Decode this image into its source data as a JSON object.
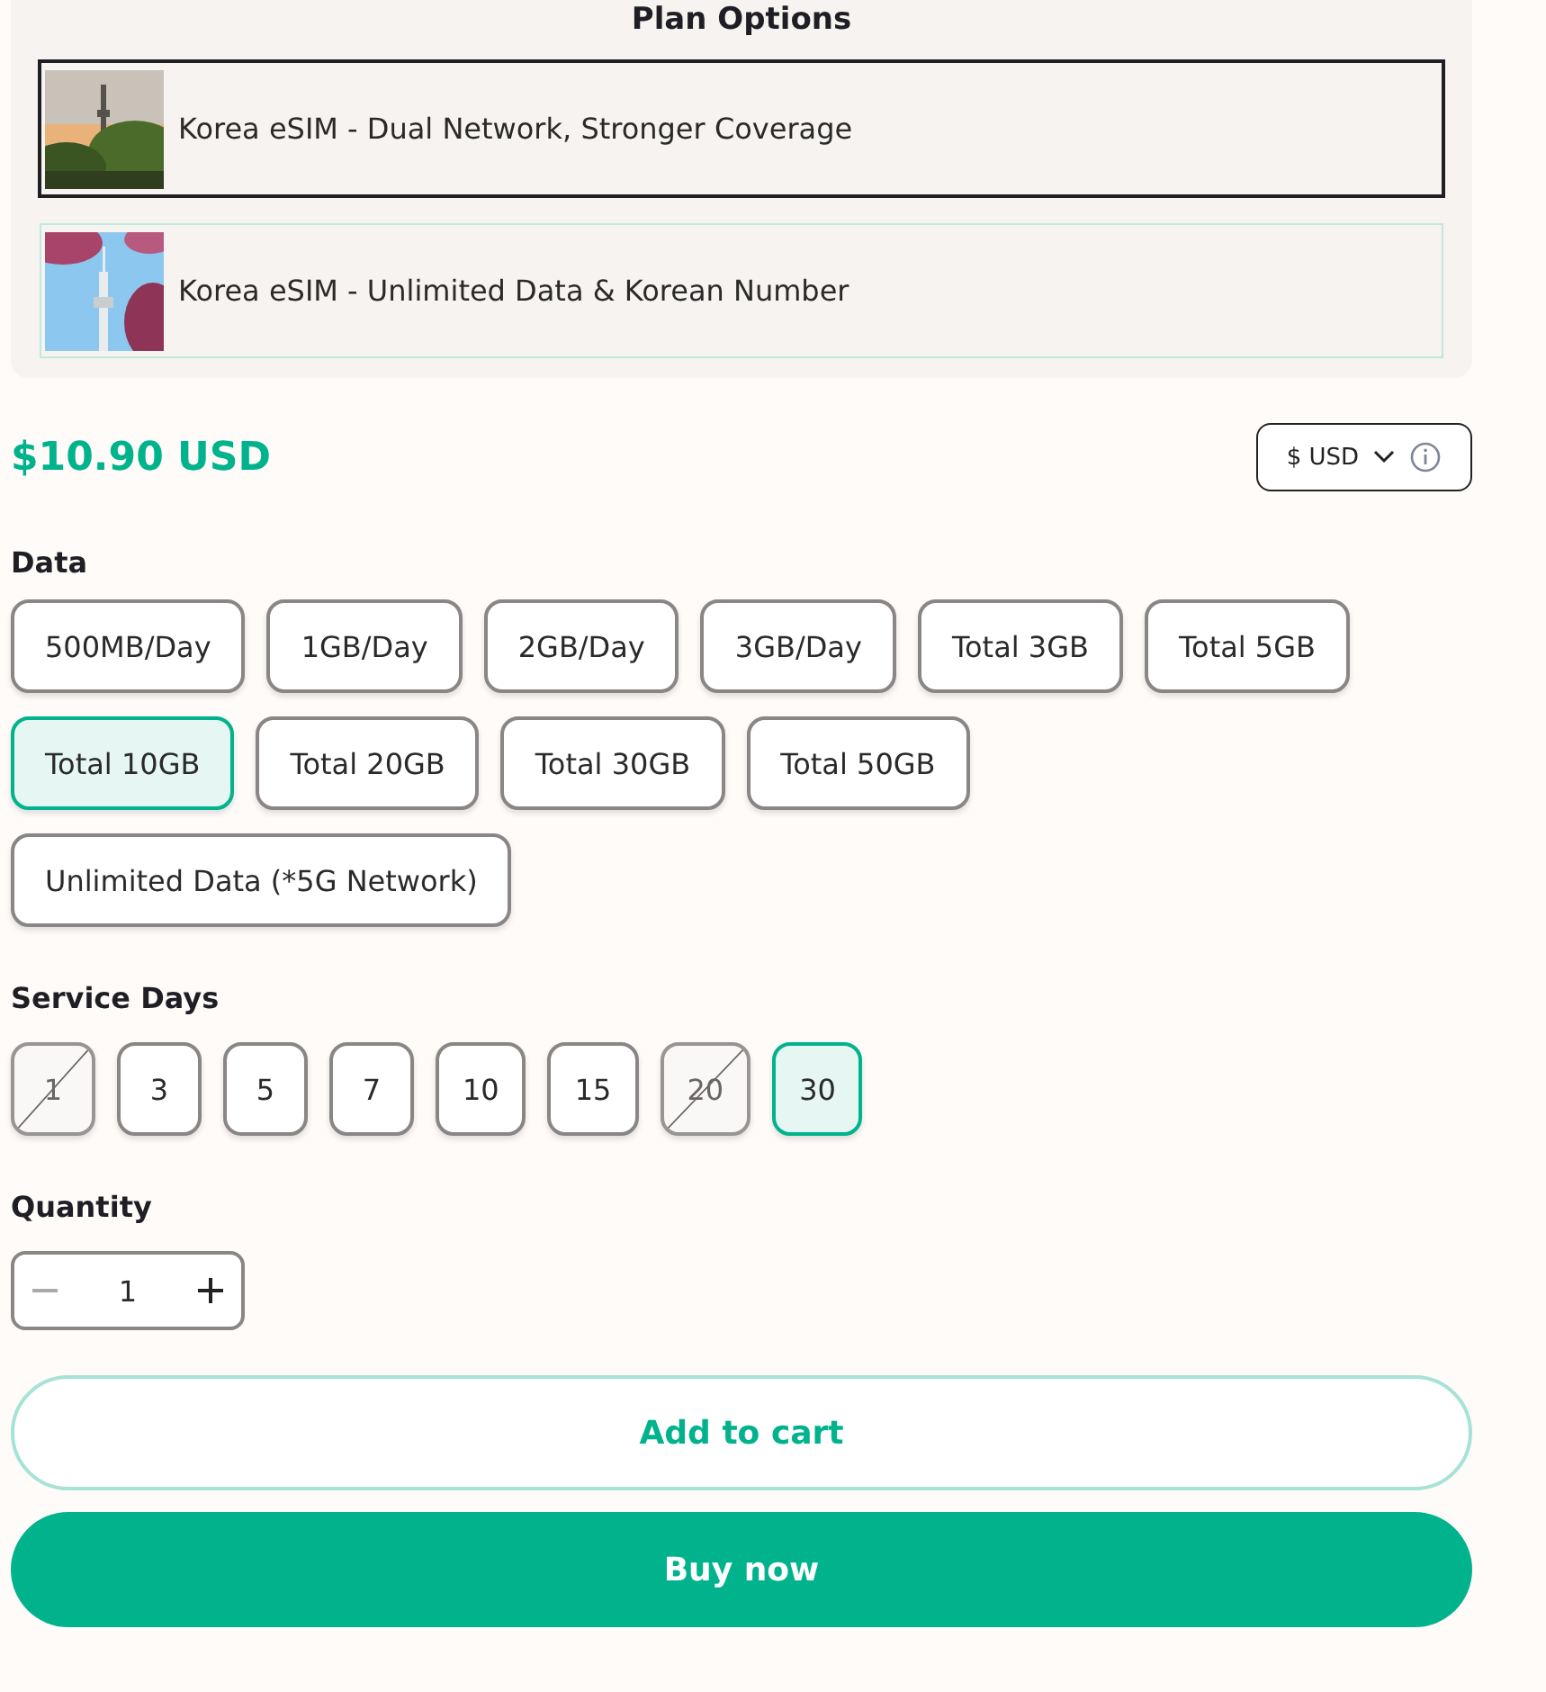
{
  "plan_options": {
    "title": "Plan Options",
    "items": [
      {
        "label": "Korea eSIM - Dual Network, Stronger Coverage",
        "selected": true,
        "kind": "sunset"
      },
      {
        "label": "Korea eSIM - Unlimited Data & Korean Number",
        "selected": false,
        "kind": "blossom"
      }
    ]
  },
  "price": "$10.90 USD",
  "currency": {
    "label": "$ USD"
  },
  "data": {
    "title": "Data",
    "options": [
      {
        "label": "500MB/Day",
        "selected": false
      },
      {
        "label": "1GB/Day",
        "selected": false
      },
      {
        "label": "2GB/Day",
        "selected": false
      },
      {
        "label": "3GB/Day",
        "selected": false
      },
      {
        "label": "Total 3GB",
        "selected": false
      },
      {
        "label": "Total 5GB",
        "selected": false
      },
      {
        "label": "Total 10GB",
        "selected": true
      },
      {
        "label": "Total 20GB",
        "selected": false
      },
      {
        "label": "Total 30GB",
        "selected": false
      },
      {
        "label": "Total 50GB",
        "selected": false
      },
      {
        "label": "Unlimited Data (*5G Network)",
        "selected": false
      }
    ]
  },
  "service_days": {
    "title": "Service Days",
    "options": [
      {
        "label": "1",
        "selected": false,
        "disabled": true
      },
      {
        "label": "3",
        "selected": false,
        "disabled": false
      },
      {
        "label": "5",
        "selected": false,
        "disabled": false
      },
      {
        "label": "7",
        "selected": false,
        "disabled": false
      },
      {
        "label": "10",
        "selected": false,
        "disabled": false
      },
      {
        "label": "15",
        "selected": false,
        "disabled": false
      },
      {
        "label": "20",
        "selected": false,
        "disabled": true
      },
      {
        "label": "30",
        "selected": true,
        "disabled": false
      }
    ]
  },
  "quantity": {
    "title": "Quantity",
    "value": "1",
    "minus_disabled": true
  },
  "buttons": [
    {
      "label": "Add to cart",
      "kind": "outline"
    },
    {
      "label": "Buy now",
      "kind": "solid"
    }
  ]
}
